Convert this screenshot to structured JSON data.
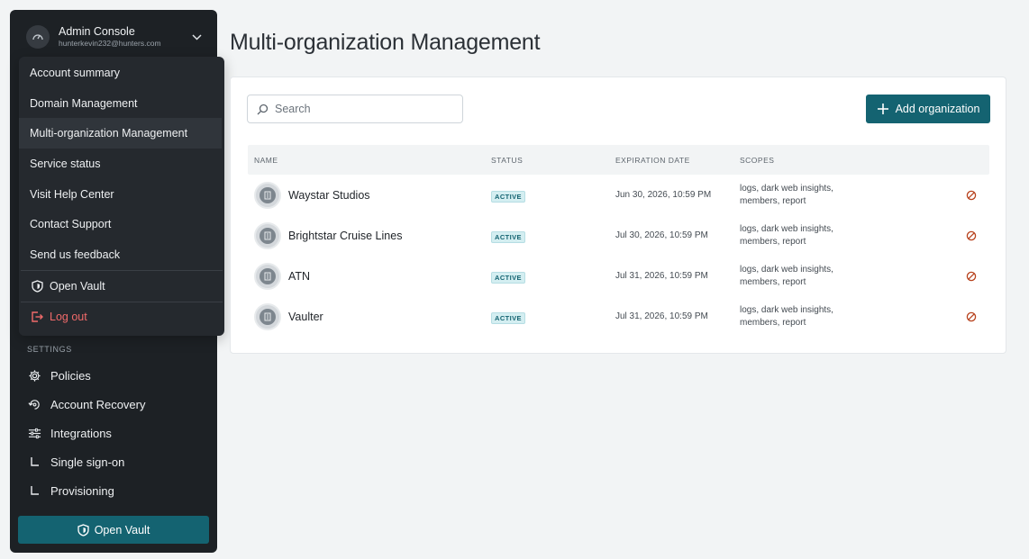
{
  "account": {
    "name": "Admin Console",
    "email": "hunterkevin232@hunters.com"
  },
  "dropdown": {
    "items": [
      {
        "label": "Account summary"
      },
      {
        "label": "Domain Management"
      },
      {
        "label": "Multi-organization Management",
        "active": true
      },
      {
        "label": "Service status"
      },
      {
        "label": "Visit Help Center"
      },
      {
        "label": "Contact Support"
      },
      {
        "label": "Send us feedback"
      }
    ],
    "open_vault": "Open Vault",
    "logout": "Log out"
  },
  "sidebar": {
    "settings_label": "SETTINGS",
    "items": [
      {
        "label": "Policies",
        "icon": "gear-icon"
      },
      {
        "label": "Account Recovery",
        "icon": "key-recovery-icon"
      },
      {
        "label": "Integrations",
        "icon": "sliders-icon"
      },
      {
        "label": "Single sign-on",
        "icon": "corner-icon"
      },
      {
        "label": "Provisioning",
        "icon": "corner-icon"
      }
    ],
    "open_vault": "Open Vault"
  },
  "page": {
    "title": "Multi-organization Management"
  },
  "search": {
    "placeholder": "Search"
  },
  "add_button": "Add organization",
  "table": {
    "headers": [
      "NAME",
      "STATUS",
      "EXPIRATION DATE",
      "SCOPES"
    ],
    "rows": [
      {
        "name": "Waystar Studios",
        "status": "ACTIVE",
        "expiration": "Jun 30, 2026, 10:59 PM",
        "scopes": "logs, dark web insights, members, report"
      },
      {
        "name": "Brightstar Cruise Lines",
        "status": "ACTIVE",
        "expiration": "Jul 30, 2026, 10:59 PM",
        "scopes": "logs, dark web insights, members, report"
      },
      {
        "name": "ATN",
        "status": "ACTIVE",
        "expiration": "Jul 31, 2026, 10:59 PM",
        "scopes": "logs, dark web insights, members, report"
      },
      {
        "name": "Vaulter",
        "status": "ACTIVE",
        "expiration": "Jul 31, 2026, 10:59 PM",
        "scopes": "logs, dark web insights, members, report"
      }
    ]
  },
  "colors": {
    "accent": "#146371",
    "sidebar_bg": "#1d2125",
    "logout": "#f06a6a",
    "revoke": "#b8431e"
  }
}
